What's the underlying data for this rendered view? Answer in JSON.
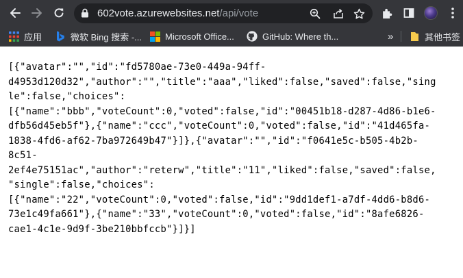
{
  "browser": {
    "url_host": "602vote.azurewebsites.net",
    "url_path": "/api/vote"
  },
  "bookmarks": [
    {
      "label": "应用",
      "icon": "apps-grid-icon"
    },
    {
      "label": "微软 Bing 搜索 -...",
      "icon": "bing-icon"
    },
    {
      "label": "Microsoft Office...",
      "icon": "microsoft-icon"
    },
    {
      "label": "GitHub: Where th...",
      "icon": "github-icon"
    },
    {
      "label": "其他书签",
      "icon": "folder-icon"
    }
  ],
  "overflow_label": "»",
  "colors": {
    "toolbar_bg": "#35363a",
    "omnibox_bg": "#202124",
    "bing_blue": "#2680eb",
    "ms_red": "#f25022",
    "ms_green": "#7fba00",
    "ms_blue": "#00a4ef",
    "ms_yellow": "#ffb900",
    "folder_yellow": "#f7cb4d"
  },
  "json_lines": [
    "[{\"avatar\":\"\",\"id\":\"fd5780ae-73e0-449a-94ff-",
    "d4953d120d32\",\"author\":\"\",\"title\":\"aaa\",\"liked\":false,\"saved\":false,\"sing",
    "le\":false,\"choices\":",
    "[{\"name\":\"bbb\",\"voteCount\":0,\"voted\":false,\"id\":\"00451b18-d287-4d86-b1e6-",
    "dfb56d45eb5f\"},{\"name\":\"ccc\",\"voteCount\":0,\"voted\":false,\"id\":\"41d465fa-",
    "1838-4fd6-af62-7ba972649b47\"}]},{\"avatar\":\"\",\"id\":\"f0641e5c-b505-4b2b-",
    "8c51-",
    "2ef4e75151ac\",\"author\":\"reterw\",\"title\":\"11\",\"liked\":false,\"saved\":false,",
    "\"single\":false,\"choices\":",
    "[{\"name\":\"22\",\"voteCount\":0,\"voted\":false,\"id\":\"9dd1def1-a7df-4dd6-b8d6-",
    "73e1c49fa661\"},{\"name\":\"33\",\"voteCount\":0,\"voted\":false,\"id\":\"8afe6826-",
    "cae1-4c1e-9d9f-3be210bbfccb\"}]}]"
  ]
}
